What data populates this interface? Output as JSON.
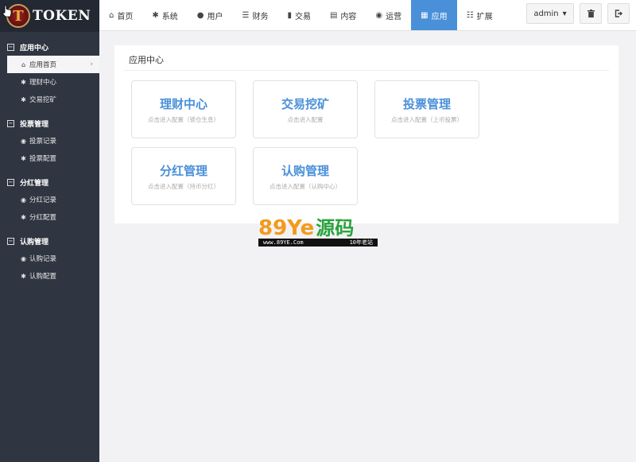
{
  "logo": {
    "mark": "T",
    "text": "TOKEN"
  },
  "sidebar": {
    "groups": [
      {
        "title": "应用中心",
        "toggle": "−",
        "items": [
          {
            "label": "应用首页",
            "icon": "home-icon"
          },
          {
            "label": "理财中心",
            "icon": "gear-icon"
          },
          {
            "label": "交易挖矿",
            "icon": "gear-icon"
          }
        ]
      },
      {
        "title": "投票管理",
        "toggle": "−",
        "items": [
          {
            "label": "投票记录",
            "icon": "globe-icon"
          },
          {
            "label": "投票配置",
            "icon": "gear-icon"
          }
        ]
      },
      {
        "title": "分红管理",
        "toggle": "−",
        "items": [
          {
            "label": "分红记录",
            "icon": "globe-icon"
          },
          {
            "label": "分红配置",
            "icon": "gear-icon"
          }
        ]
      },
      {
        "title": "认购管理",
        "toggle": "−",
        "items": [
          {
            "label": "认购记录",
            "icon": "globe-icon"
          },
          {
            "label": "认购配置",
            "icon": "gear-icon"
          }
        ]
      }
    ]
  },
  "topnav": {
    "items": [
      {
        "label": "首页",
        "icon": "home-icon"
      },
      {
        "label": "系统",
        "icon": "gear-icon"
      },
      {
        "label": "用户",
        "icon": "user-icon"
      },
      {
        "label": "财务",
        "icon": "list-icon"
      },
      {
        "label": "交易",
        "icon": "bar-chart-icon"
      },
      {
        "label": "内容",
        "icon": "document-icon"
      },
      {
        "label": "运营",
        "icon": "globe-icon"
      },
      {
        "label": "应用",
        "icon": "grid-icon"
      },
      {
        "label": "扩展",
        "icon": "server-icon"
      }
    ],
    "user": "admin"
  },
  "panel": {
    "title": "应用中心",
    "cards": [
      {
        "title": "理财中心",
        "sub": "点击进入配置（锁仓生息）"
      },
      {
        "title": "交易挖矿",
        "sub": "点击进入配置"
      },
      {
        "title": "投票管理",
        "sub": "点击进入配置（上币投票）"
      },
      {
        "title": "分红管理",
        "sub": "点击进入配置（持币分红）"
      },
      {
        "title": "认购管理",
        "sub": "点击进入配置（认购中心）"
      }
    ]
  },
  "watermark": {
    "num": "89Ye",
    "cn": "源码",
    "url": "www.89YE.Com",
    "tag": "10年老站"
  },
  "colors": {
    "accent": "#4a90d9",
    "sidebar": "#2f3541"
  }
}
